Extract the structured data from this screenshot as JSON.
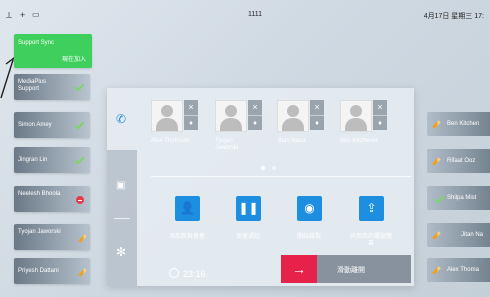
{
  "status_bar": {
    "icons": [
      "network-icon",
      "add-icon",
      "screen-icon"
    ],
    "center_number": "1111",
    "datetime": "4月17日 星期三  17:"
  },
  "participants": [
    {
      "name": "Support Sync",
      "sub": "現在加入",
      "status": "sync"
    },
    {
      "name": "MediaPlus Support",
      "status": "check"
    },
    {
      "name": "Simon Amey",
      "status": "check"
    },
    {
      "name": "Jingran Lin",
      "status": "check"
    },
    {
      "name": "Neelesh Bhoola",
      "status": "declined"
    },
    {
      "name": "Tyojan Jaworski",
      "status": "pencil"
    },
    {
      "name": "Priyesh Dattani",
      "status": "pencil"
    }
  ],
  "right_list": [
    {
      "name": "Ben Kitchen",
      "status": "pencil"
    },
    {
      "name": "Rifaat Ooz",
      "status": "pencil"
    },
    {
      "name": "Shilpa Mist",
      "status": "check"
    },
    {
      "name": "Jitan Na",
      "status": "pencil"
    },
    {
      "name": "Alex Thoma",
      "status": "pencil"
    }
  ],
  "call_panel": {
    "attendees": [
      {
        "name": "Alex Thomson"
      },
      {
        "name": "Tyojan Jaworski"
      },
      {
        "name": "Jitan Nana"
      },
      {
        "name": "Ben Kitchener"
      }
    ],
    "page_dots": 2,
    "active_page": 1,
    "actions": [
      {
        "icon": "add-person-icon",
        "label": "添加新與會者"
      },
      {
        "icon": "pause-icon",
        "label": "保留通話"
      },
      {
        "icon": "record-icon",
        "label": "開始錄製"
      },
      {
        "icon": "share-screen-icon",
        "label": "共用我的電腦螢幕"
      }
    ],
    "timer": "23:16",
    "leave_label": "滑動離開"
  },
  "colors": {
    "sync_green": "#3fcf5c",
    "action_blue": "#1e8fe0",
    "leave_red": "#e63a4b"
  }
}
